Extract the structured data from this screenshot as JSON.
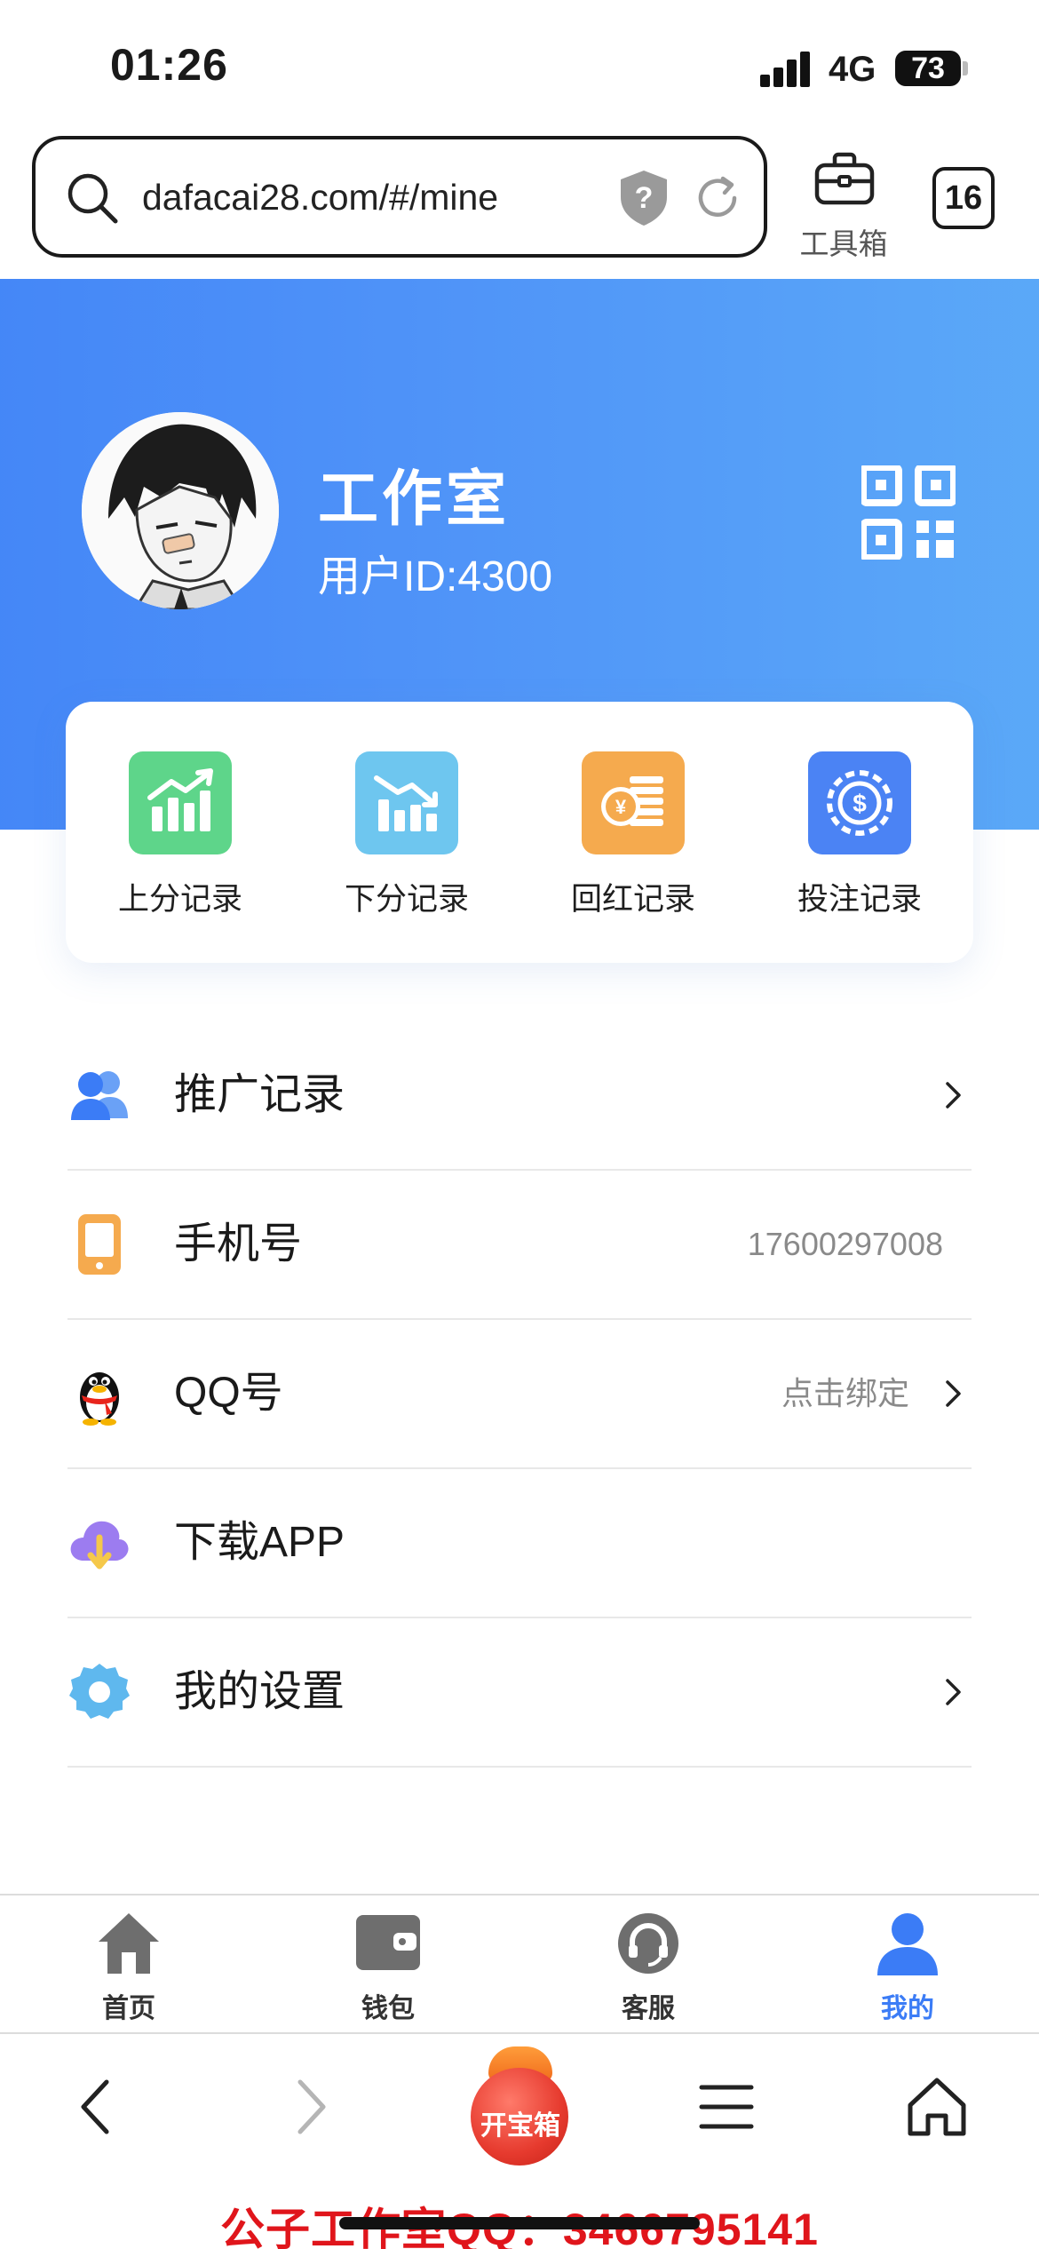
{
  "status_bar": {
    "time": "01:26",
    "network": "4G",
    "battery": "73"
  },
  "browser": {
    "url": "dafacai28.com/#/mine",
    "toolbox_label": "工具箱",
    "tab_count": "16"
  },
  "profile": {
    "name": "工作室",
    "user_id": "用户ID:4300"
  },
  "quick_actions": [
    {
      "label": "上分记录",
      "color": "#5ed58a",
      "icon": "bar-chart-up-icon"
    },
    {
      "label": "下分记录",
      "color": "#6ec6ef",
      "icon": "bar-chart-down-icon"
    },
    {
      "label": "回红记录",
      "color": "#f5aa4e",
      "icon": "coins-icon"
    },
    {
      "label": "投注记录",
      "color": "#4b83f4",
      "icon": "chip-icon"
    }
  ],
  "menu": [
    {
      "label": "推广记录",
      "value": "",
      "icon": "users-icon"
    },
    {
      "label": "手机号",
      "value": "17600297008",
      "icon": "phone-icon"
    },
    {
      "label": "QQ号",
      "value": "点击绑定",
      "icon": "qq-penguin-icon"
    },
    {
      "label": "下载APP",
      "value": "",
      "icon": "cloud-download-icon"
    },
    {
      "label": "我的设置",
      "value": "",
      "icon": "gear-icon"
    }
  ],
  "tabbar": [
    {
      "label": "首页",
      "icon": "home-icon"
    },
    {
      "label": "钱包",
      "icon": "wallet-icon"
    },
    {
      "label": "客服",
      "icon": "headset-icon"
    },
    {
      "label": "我的",
      "icon": "user-icon",
      "active": true
    }
  ],
  "browser_nav": {
    "treasure_label": "开宝箱"
  },
  "watermark": "公子工作室QQ：3466795141",
  "colors": {
    "accent": "#3b7cf6",
    "gradient_end": "#62b6f7"
  }
}
